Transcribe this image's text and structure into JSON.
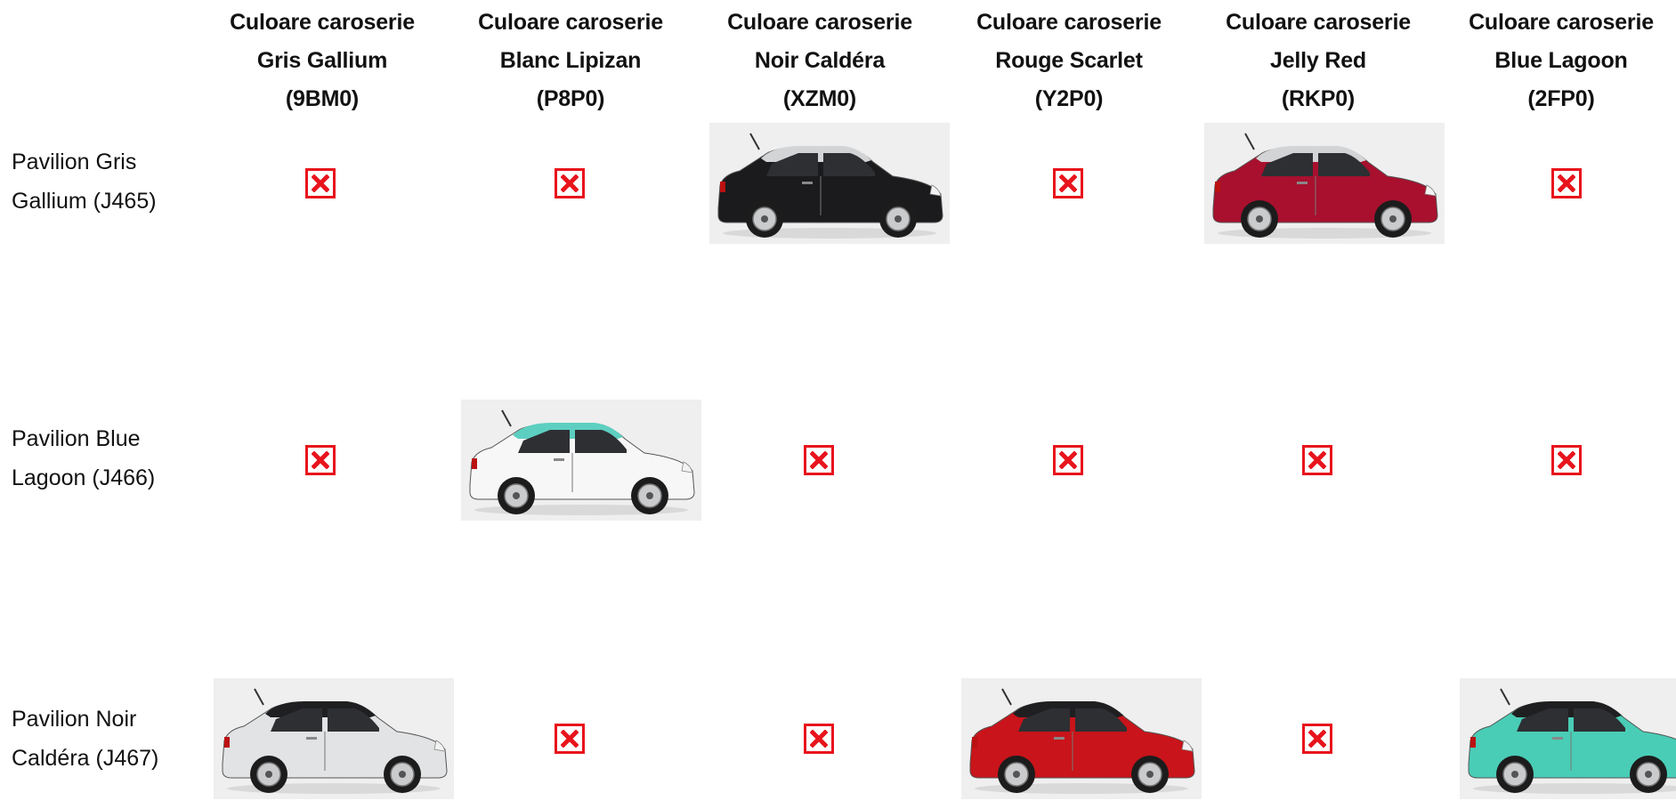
{
  "columns": [
    {
      "line1": "Culoare caroserie",
      "line2": "Gris Gallium",
      "line3": "(9BM0)"
    },
    {
      "line1": "Culoare caroserie",
      "line2": "Blanc Lipizan",
      "line3": "(P8P0)"
    },
    {
      "line1": "Culoare caroserie",
      "line2": "Noir Caldéra",
      "line3": "(XZM0)"
    },
    {
      "line1": "Culoare caroserie",
      "line2": "Rouge Scarlet",
      "line3": "(Y2P0)"
    },
    {
      "line1": "Culoare caroserie",
      "line2": "Jelly Red",
      "line3": "(RKP0)"
    },
    {
      "line1": "Culoare caroserie",
      "line2": "Blue Lagoon",
      "line3": "(2FP0)"
    }
  ],
  "rows": [
    {
      "line1": "Pavilion Gris",
      "line2": "Gallium (J465)"
    },
    {
      "line1": "Pavilion Blue",
      "line2": "Lagoon (J466)"
    },
    {
      "line1": "Pavilion Noir",
      "line2": "Caldéra (J467)"
    }
  ],
  "colors": {
    "broken_icon": "#e8141c",
    "body_gris_gallium": "#e1e3e4",
    "body_blanc_lipizan": "#f7f7f7",
    "body_noir_caldera": "#1b1b1d",
    "body_rouge_scarlet": "#c8141a",
    "body_jelly_red": "#a8102e",
    "body_blue_lagoon": "#49cdb6",
    "roof_gris_gallium": "#d2d4d6",
    "roof_blue_lagoon": "#5dcfc0",
    "roof_noir_caldera": "#1f1f21"
  },
  "cells": [
    {
      "type": "broken"
    },
    {
      "type": "broken"
    },
    {
      "type": "car",
      "body": "#1b1b1d",
      "roof": "#d2d4d6"
    },
    {
      "type": "broken"
    },
    {
      "type": "car",
      "body": "#a8102e",
      "roof": "#d2d4d6"
    },
    {
      "type": "broken"
    },
    {
      "type": "broken"
    },
    {
      "type": "car",
      "body": "#f7f7f7",
      "roof": "#5dcfc0"
    },
    {
      "type": "broken"
    },
    {
      "type": "broken"
    },
    {
      "type": "broken"
    },
    {
      "type": "broken"
    },
    {
      "type": "car",
      "body": "#e1e3e4",
      "roof": "#1f1f21"
    },
    {
      "type": "broken"
    },
    {
      "type": "broken"
    },
    {
      "type": "car",
      "body": "#c8141a",
      "roof": "#1f1f21"
    },
    {
      "type": "broken"
    },
    {
      "type": "car",
      "body": "#49cdb6",
      "roof": "#1f1f21"
    }
  ],
  "icons": {
    "broken_image": "broken-image-icon"
  }
}
